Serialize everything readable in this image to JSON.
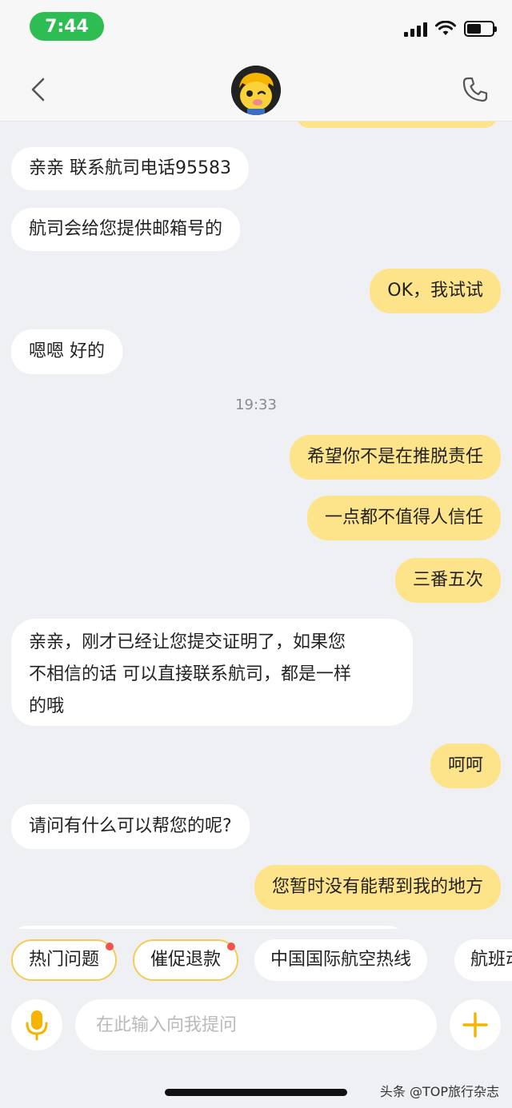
{
  "status_bar": {
    "time": "7:44"
  },
  "nav": {
    "back_icon": "chevron-left-icon",
    "avatar_icon": "mascot-avatar",
    "call_icon": "phone-icon"
  },
  "messages": [
    {
      "side": "left",
      "text": "亲亲 联系航司电话95583"
    },
    {
      "side": "left",
      "text": "航司会给您提供邮箱号的"
    },
    {
      "side": "right",
      "text": "OK，我试试"
    },
    {
      "side": "left",
      "text": "嗯嗯 好的"
    },
    {
      "side": "right",
      "text": "希望你不是在推脱责任"
    },
    {
      "side": "right",
      "text": "一点都不值得人信任"
    },
    {
      "side": "right",
      "text": "三番五次"
    },
    {
      "side": "left",
      "lines": [
        "亲亲，刚才已经让您提交证明了，如果您",
        "不相信的话 可以直接联系航司，都是一样",
        "的哦"
      ]
    },
    {
      "side": "right",
      "text": "呵呵"
    },
    {
      "side": "left",
      "text": "请问有什么可以帮您的呢?"
    },
    {
      "side": "right",
      "text": "您暂时没有能帮到我的地方"
    }
  ],
  "timestamp": "19:33",
  "quick_replies": [
    {
      "label": "热门问题",
      "badge": true
    },
    {
      "label": "催促退款",
      "badge": true
    },
    {
      "label": "中国国际航空热线",
      "badge": false
    },
    {
      "label": "航班动",
      "badge": false
    }
  ],
  "input": {
    "placeholder": "在此输入向我提问",
    "mic_icon": "microphone-icon",
    "plus_icon": "plus-icon"
  },
  "watermark": "头条 @TOP旅行杂志",
  "colors": {
    "accent": "#fde48a",
    "status_green": "#2ebd52",
    "badge_red": "#ef5350",
    "icon_yellow": "#f5b400"
  }
}
